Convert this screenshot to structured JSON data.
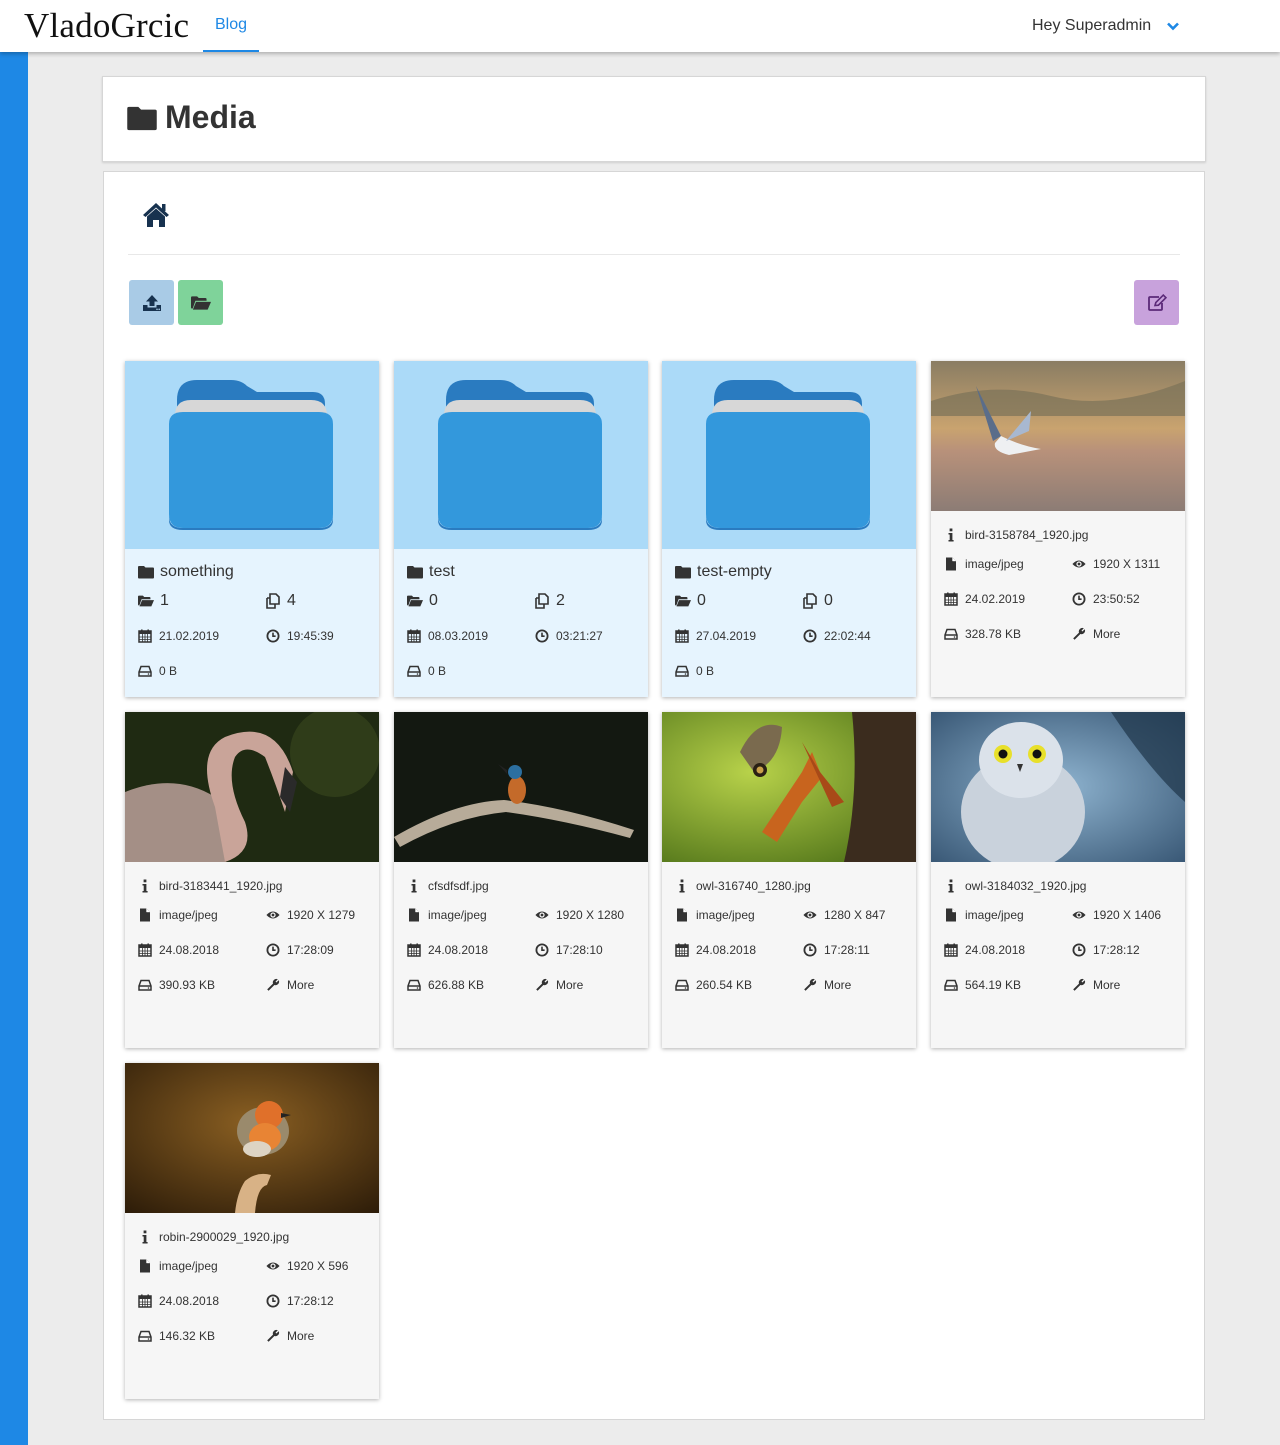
{
  "nav": {
    "logo": "VladoGrcic",
    "blog_link": "Blog",
    "user_greeting": "Hey Superadmin"
  },
  "colors": {
    "accent": "#1e88e5",
    "upload": "#a9cbe6",
    "new_folder": "#7fd39a",
    "edit": "#c8a2dc",
    "folder_thumb": "#abdaf8"
  },
  "page": {
    "title": "Media"
  },
  "toolbar": {
    "upload_icon": "upload-icon",
    "new_folder_icon": "folder-open-icon",
    "edit_icon": "edit-icon"
  },
  "folders": [
    {
      "name": "something",
      "folders": "1",
      "files": "4",
      "date": "21.02.2019",
      "time": "19:45:39",
      "size": "0 B"
    },
    {
      "name": "test",
      "folders": "0",
      "files": "2",
      "date": "08.03.2019",
      "time": "03:21:27",
      "size": "0 B"
    },
    {
      "name": "test-empty",
      "folders": "0",
      "files": "0",
      "date": "27.04.2019",
      "time": "22:02:44",
      "size": "0 B"
    }
  ],
  "images": [
    {
      "name": "bird-3158784_1920.jpg",
      "type": "image/jpeg",
      "dims": "1920 X 1311",
      "date": "24.02.2019",
      "time": "23:50:52",
      "size": "328.78 KB",
      "more": "More"
    },
    {
      "name": "bird-3183441_1920.jpg",
      "type": "image/jpeg",
      "dims": "1920 X 1279",
      "date": "24.08.2018",
      "time": "17:28:09",
      "size": "390.93 KB",
      "more": "More"
    },
    {
      "name": "cfsdfsdf.jpg",
      "type": "image/jpeg",
      "dims": "1920 X 1280",
      "date": "24.08.2018",
      "time": "17:28:10",
      "size": "626.88 KB",
      "more": "More"
    },
    {
      "name": "owl-316740_1280.jpg",
      "type": "image/jpeg",
      "dims": "1280 X 847",
      "date": "24.08.2018",
      "time": "17:28:11",
      "size": "260.54 KB",
      "more": "More"
    },
    {
      "name": "owl-3184032_1920.jpg",
      "type": "image/jpeg",
      "dims": "1920 X 1406",
      "date": "24.08.2018",
      "time": "17:28:12",
      "size": "564.19 KB",
      "more": "More"
    },
    {
      "name": "robin-2900029_1920.jpg",
      "type": "image/jpeg",
      "dims": "1920 X 596",
      "date": "24.08.2018",
      "time": "17:28:12",
      "size": "146.32 KB",
      "more": "More"
    }
  ]
}
